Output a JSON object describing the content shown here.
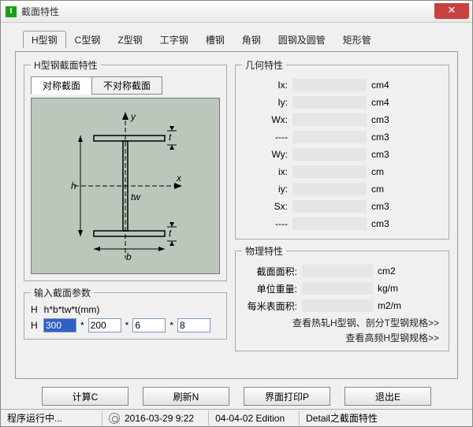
{
  "window": {
    "title": "截面特性"
  },
  "tabs": [
    "H型钢",
    "C型钢",
    "Z型钢",
    "工字钢",
    "槽钢",
    "角钢",
    "圆钢及圆管",
    "矩形管"
  ],
  "active_tab": 0,
  "section": {
    "group_title": "H型钢截面特性",
    "sym_tabs": [
      "对称截面",
      "不对称截面"
    ],
    "sym_active": 0,
    "diagram_labels": {
      "y": "y",
      "x": "x",
      "h": "h",
      "b": "b",
      "tw": "tw",
      "t": "t"
    }
  },
  "params": {
    "group_title": "输入截面参数",
    "format_label": "H",
    "format_text": "h*b*tw*t(mm)",
    "row_label": "H",
    "values": [
      "300",
      "200",
      "6",
      "8"
    ],
    "selected_index": 0
  },
  "geom": {
    "group_title": "几何特性",
    "rows": [
      {
        "label": "Ix:",
        "value": "",
        "unit": "cm4"
      },
      {
        "label": "Iy:",
        "value": "",
        "unit": "cm4"
      },
      {
        "label": "Wx:",
        "value": "",
        "unit": "cm3"
      },
      {
        "label": "----",
        "value": "",
        "unit": "cm3"
      },
      {
        "label": "Wy:",
        "value": "",
        "unit": "cm3"
      },
      {
        "label": "ix:",
        "value": "",
        "unit": "cm"
      },
      {
        "label": "iy:",
        "value": "",
        "unit": "cm"
      },
      {
        "label": "Sx:",
        "value": "",
        "unit": "cm3"
      },
      {
        "label": "----",
        "value": "",
        "unit": "cm3"
      }
    ]
  },
  "phys": {
    "group_title": "物理特性",
    "rows": [
      {
        "label": "截面面积:",
        "value": "",
        "unit": "cm2"
      },
      {
        "label": "单位重量:",
        "value": "",
        "unit": "kg/m"
      },
      {
        "label": "每米表面积:",
        "value": "",
        "unit": "m2/m"
      }
    ],
    "link1": "查看热轧H型钢、剖分T型钢规格>>",
    "link2": "查看高频H型钢规格>>"
  },
  "buttons": {
    "calc": "计算C",
    "refresh": "刷新N",
    "print": "界面打印P",
    "exit": "退出E"
  },
  "status": {
    "running": "程序运行中...",
    "datetime": "2016-03-29  9:22",
    "edition": "04-04-02 Edition",
    "detail": "Detail之截面特性"
  }
}
